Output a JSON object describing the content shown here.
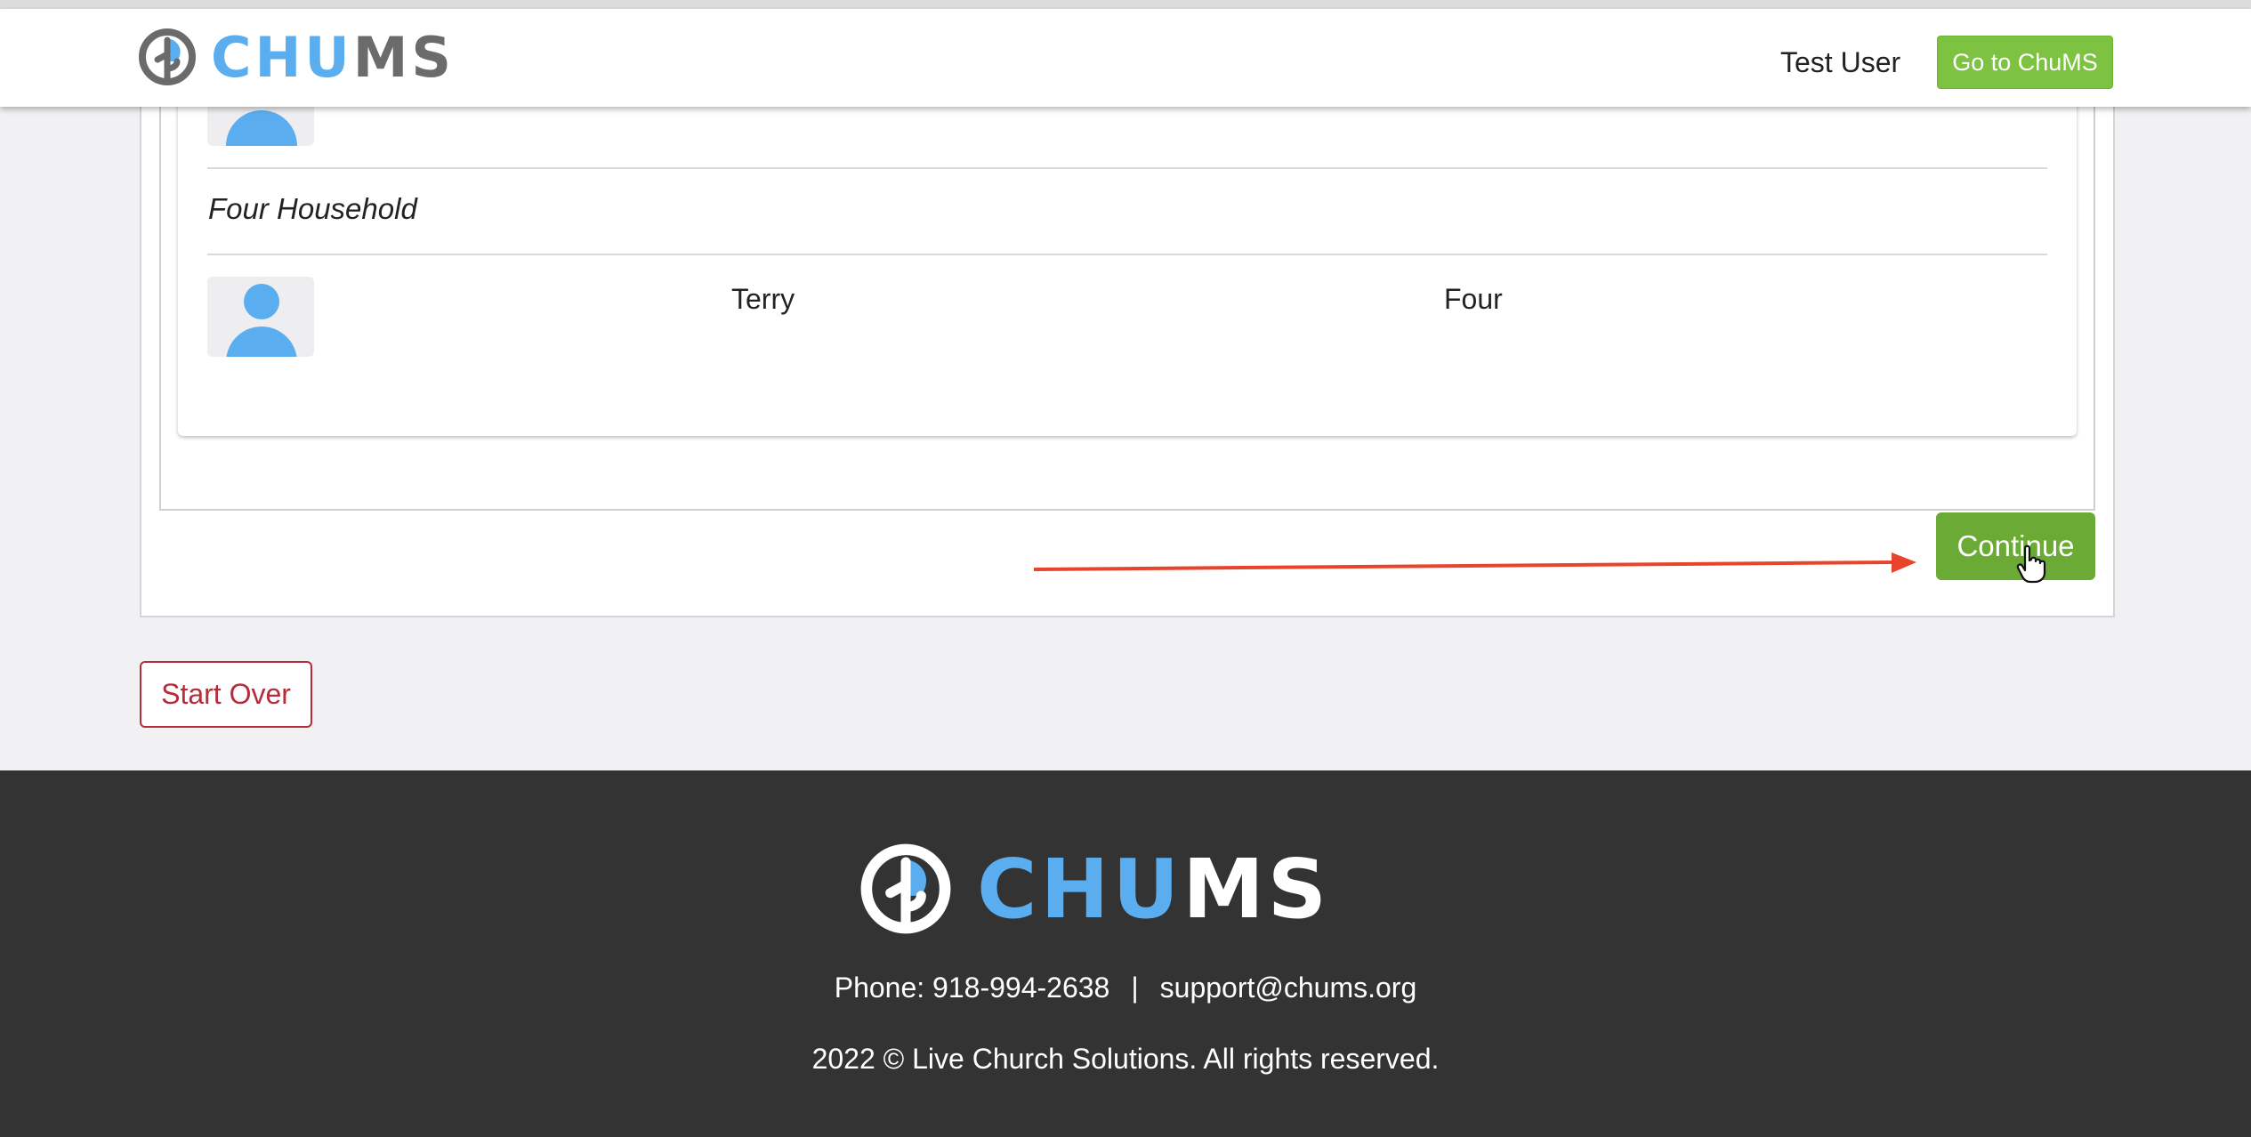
{
  "header": {
    "logo": {
      "chu": "CHU",
      "ms": "MS"
    },
    "user_name": "Test User",
    "goto_button": "Go to ChuMS"
  },
  "household": {
    "name": "Four Household",
    "members": [
      {
        "first_name": "Terry",
        "last_name": "Four"
      }
    ]
  },
  "actions": {
    "continue": "Continue",
    "start_over": "Start Over"
  },
  "footer": {
    "logo": {
      "chu": "CHU",
      "ms": "MS"
    },
    "phone": "Phone: 918-994-2638",
    "separator": "|",
    "email": "support@chums.org",
    "copyright": "2022 © Live Church Solutions. All rights reserved."
  },
  "colors": {
    "brand_blue": "#5aaef0",
    "brand_gray": "#6b6b6b",
    "green_button": "#7ec242",
    "continue_green": "#6aaa35",
    "start_over_red": "#b52c3a",
    "footer_bg": "#333333",
    "annotation_arrow": "#e8442b"
  }
}
